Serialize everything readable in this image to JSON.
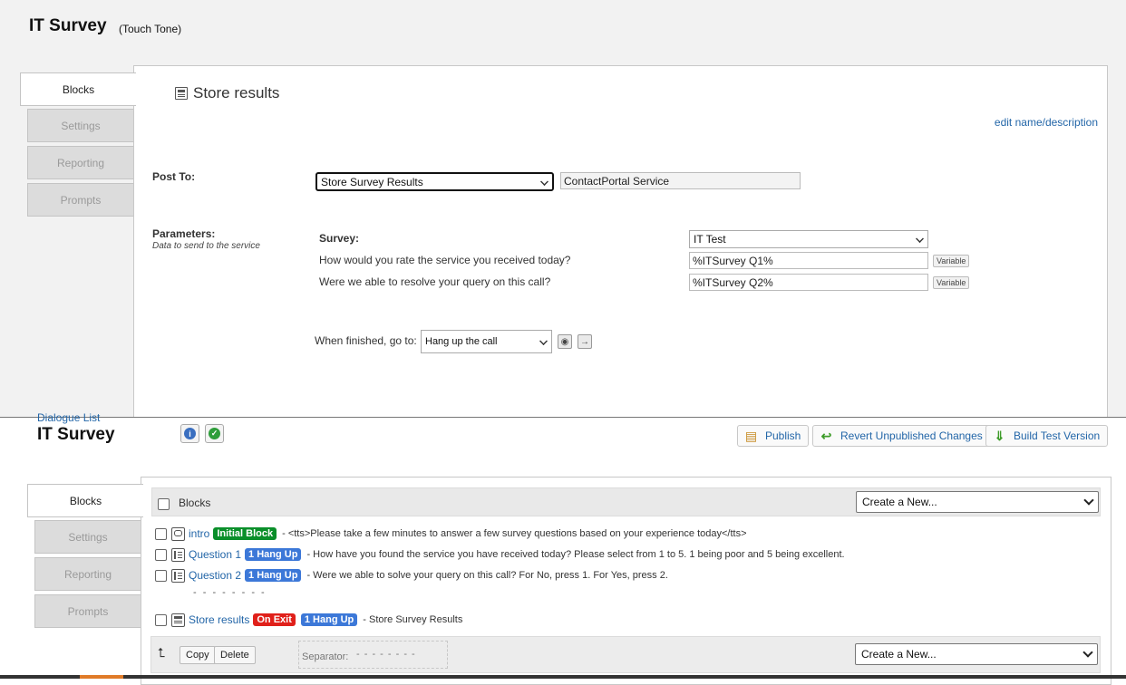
{
  "top": {
    "title": "IT Survey",
    "subtitle": "(Touch Tone)",
    "tabs": [
      "Blocks",
      "Settings",
      "Reporting",
      "Prompts"
    ],
    "block_title": "Store results",
    "edit_link": "edit name/description",
    "post_to_label": "Post To:",
    "post_to_value": "Store Survey Results",
    "service_value": "ContactPortal Service",
    "parameters_label": "Parameters:",
    "parameters_hint": "Data to send to the service",
    "survey_label": "Survey:",
    "survey_value": "IT Test",
    "params": [
      {
        "question": "How would you rate the service you received today?",
        "value": "%ITSurvey Q1%",
        "button": "Variable"
      },
      {
        "question": "Were we able to resolve your query on this call?",
        "value": "%ITSurvey Q2%",
        "button": "Variable"
      }
    ],
    "finish_label": "When finished, go to:",
    "finish_value": "Hang up the call"
  },
  "bottom": {
    "dialogue_link": "Dialogue List",
    "title": "IT Survey",
    "toolbar": {
      "publish": "Publish",
      "revert": "Revert Unpublished Changes",
      "build": "Build Test Version"
    },
    "tabs": [
      "Blocks",
      "Settings",
      "Reporting",
      "Prompts"
    ],
    "list_header": "Blocks",
    "create_new": "Create a New...",
    "rows": [
      {
        "name": "intro",
        "badge": "Initial Block",
        "desc": "- <tts>Please take a few minutes to answer a few survey questions based on your experience today</tts>"
      },
      {
        "name": "Question 1",
        "badge": "1 Hang Up",
        "desc": "- How have you found the service you have received today? Please select from 1 to 5. 1 being poor and 5 being excellent."
      },
      {
        "name": "Question 2",
        "badge": "1 Hang Up",
        "desc": "- Were we able to solve your query on this call? For No, press 1. For Yes, press 2."
      },
      {
        "name": "Store results",
        "badge": "On Exit",
        "badge2": "1 Hang Up",
        "desc": "- Store Survey Results"
      }
    ],
    "separator_dashes": "- - - - - - - -",
    "footer": {
      "copy": "Copy",
      "delete": "Delete",
      "separator_label": "Separator:",
      "separator_value": "- - - - - - - -",
      "create_new": "Create a New..."
    }
  }
}
